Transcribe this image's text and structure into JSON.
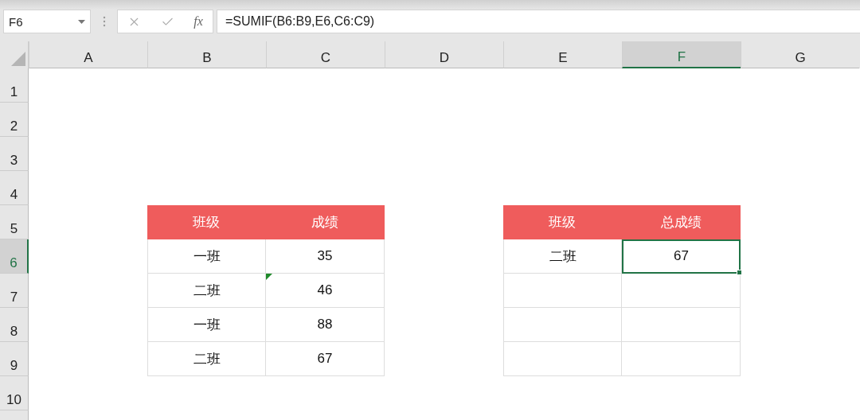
{
  "formula_bar": {
    "name_box": "F6",
    "function_label": "fx",
    "formula": "=SUMIF(B6:B9,E6,C6:C9)"
  },
  "column_headers": [
    {
      "label": "A",
      "selected": false
    },
    {
      "label": "B",
      "selected": false
    },
    {
      "label": "C",
      "selected": false
    },
    {
      "label": "D",
      "selected": false
    },
    {
      "label": "E",
      "selected": false
    },
    {
      "label": "F",
      "selected": true
    },
    {
      "label": "G",
      "selected": false
    }
  ],
  "row_headers": [
    {
      "label": "1",
      "selected": false
    },
    {
      "label": "2",
      "selected": false
    },
    {
      "label": "3",
      "selected": false
    },
    {
      "label": "4",
      "selected": false
    },
    {
      "label": "5",
      "selected": false
    },
    {
      "label": "6",
      "selected": true
    },
    {
      "label": "7",
      "selected": false
    },
    {
      "label": "8",
      "selected": false
    },
    {
      "label": "9",
      "selected": false
    },
    {
      "label": "10",
      "selected": false
    }
  ],
  "tables": [
    {
      "columns": [
        "班级",
        "成绩"
      ],
      "rows": [
        [
          {
            "text": "一班",
            "selected": false,
            "flag": false
          },
          {
            "text": "35",
            "selected": false,
            "flag": false
          }
        ],
        [
          {
            "text": "二班",
            "selected": false,
            "flag": false
          },
          {
            "text": "46",
            "selected": false,
            "flag": true
          }
        ],
        [
          {
            "text": "一班",
            "selected": false,
            "flag": false
          },
          {
            "text": "88",
            "selected": false,
            "flag": false
          }
        ],
        [
          {
            "text": "二班",
            "selected": false,
            "flag": false
          },
          {
            "text": "67",
            "selected": false,
            "flag": false
          }
        ]
      ]
    },
    {
      "columns": [
        "班级",
        "总成绩"
      ],
      "rows": [
        [
          {
            "text": "二班",
            "selected": false,
            "flag": false
          },
          {
            "text": "67",
            "selected": true,
            "flag": false
          }
        ]
      ]
    }
  ]
}
